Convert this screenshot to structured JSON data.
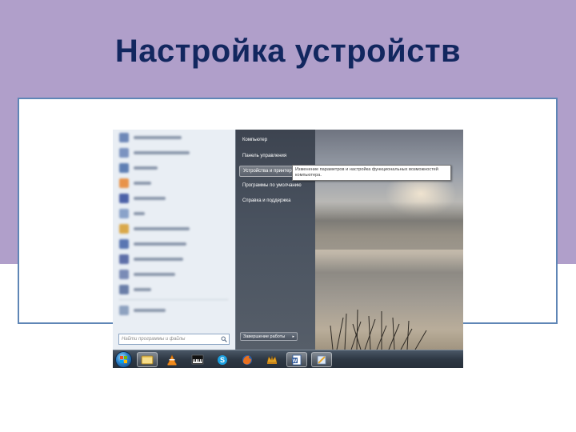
{
  "slide": {
    "title": "Настройка устройств"
  },
  "start_menu": {
    "right_items": [
      {
        "label": "Компьютер"
      },
      {
        "label": "Панель управления"
      },
      {
        "label": "Устройства и принтеры"
      },
      {
        "label": "Программы по умолчанию"
      },
      {
        "label": "Справка и поддержка"
      }
    ],
    "highlighted_item": "Устройства и принтеры",
    "tooltip": "Изменение параметров и настройка функциональных возможностей компьютера.",
    "search_placeholder": "Найти программы и файлы",
    "shutdown_label": "Завершение работы"
  },
  "taskbar": {
    "pinned": [
      "windows-explorer-icon",
      "vlc-icon",
      "piano-icon",
      "skype-icon",
      "firefox-icon",
      "game-icon",
      "word-icon",
      "window-icon"
    ]
  },
  "colors": {
    "title": "#12275f",
    "band": "#b09fca",
    "frame_border": "#5f86b6"
  }
}
